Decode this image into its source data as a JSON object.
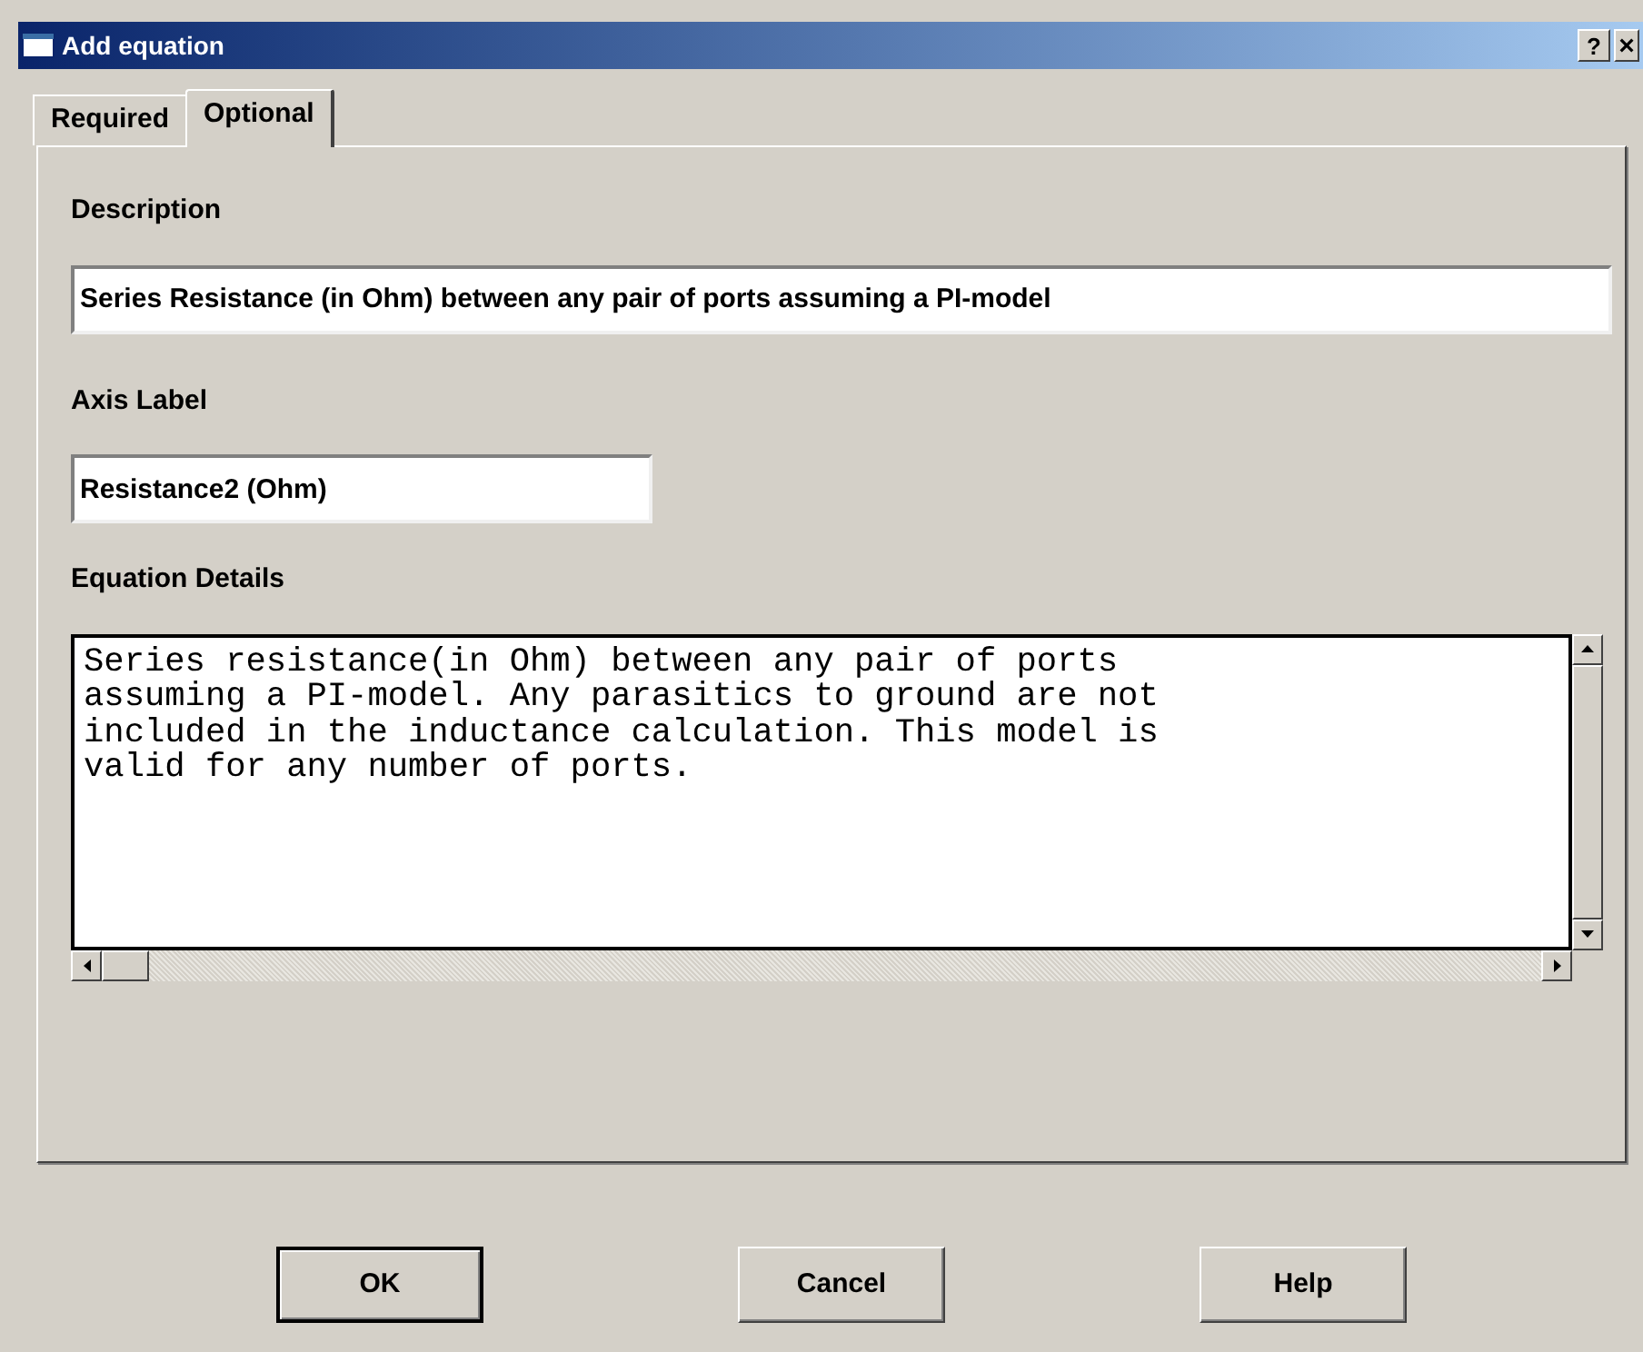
{
  "window": {
    "title": "Add equation",
    "help_button": "?",
    "close_button": "×"
  },
  "tabs": [
    {
      "label": "Required",
      "selected": false
    },
    {
      "label": "Optional",
      "selected": true
    }
  ],
  "description": {
    "label": "Description",
    "value": "Series Resistance (in Ohm) between any pair of ports assuming a PI-model"
  },
  "axis_label": {
    "label": "Axis Label",
    "value": "Resistance2 (Ohm)"
  },
  "equation_details": {
    "label": "Equation Details",
    "lines": [
      "Series resistance(in Ohm) between any pair of ports",
      "assuming a PI-model. Any parasitics to ground are not",
      "included in the inductance calculation. This model is",
      "valid for any number of ports."
    ]
  },
  "buttons": [
    {
      "label": "OK",
      "default": true
    },
    {
      "label": "Cancel",
      "default": false
    },
    {
      "label": "Help",
      "default": false
    }
  ]
}
